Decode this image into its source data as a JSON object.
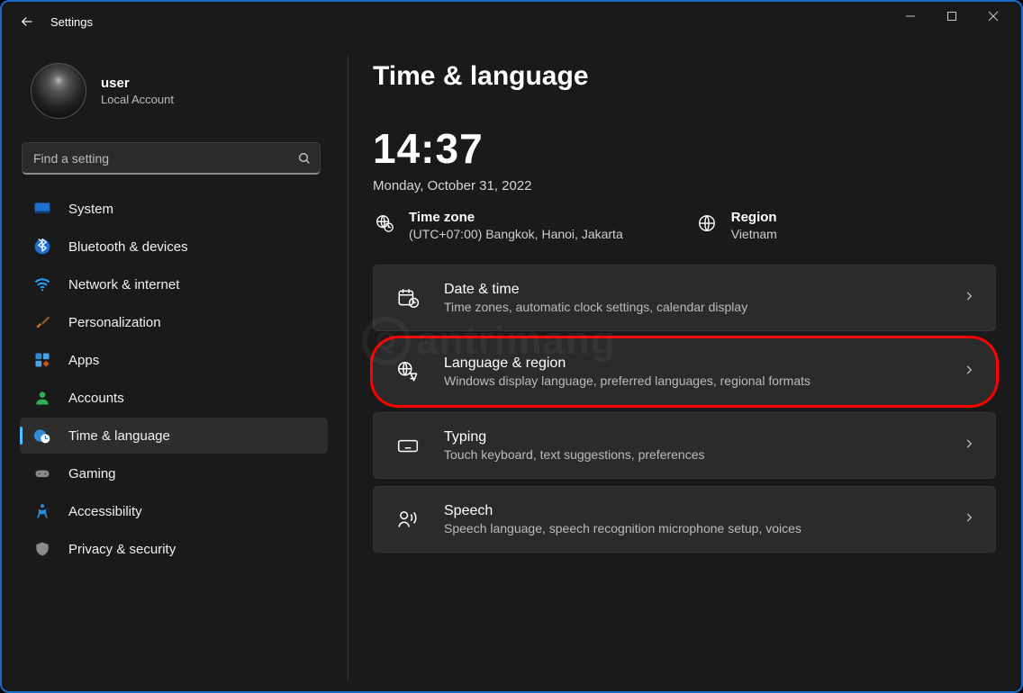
{
  "app": {
    "title": "Settings"
  },
  "profile": {
    "name": "user",
    "subtitle": "Local Account"
  },
  "search": {
    "placeholder": "Find a setting"
  },
  "sidebar": {
    "items": [
      {
        "label": "System"
      },
      {
        "label": "Bluetooth & devices"
      },
      {
        "label": "Network & internet"
      },
      {
        "label": "Personalization"
      },
      {
        "label": "Apps"
      },
      {
        "label": "Accounts"
      },
      {
        "label": "Time & language"
      },
      {
        "label": "Gaming"
      },
      {
        "label": "Accessibility"
      },
      {
        "label": "Privacy & security"
      }
    ],
    "active_index": 6
  },
  "page": {
    "title": "Time & language",
    "clock_time": "14:37",
    "clock_date": "Monday, October 31, 2022",
    "timezone": {
      "title": "Time zone",
      "value": "(UTC+07:00) Bangkok, Hanoi, Jakarta"
    },
    "region": {
      "title": "Region",
      "value": "Vietnam"
    },
    "cards": [
      {
        "title": "Date & time",
        "subtitle": "Time zones, automatic clock settings, calendar display"
      },
      {
        "title": "Language & region",
        "subtitle": "Windows display language, preferred languages, regional formats"
      },
      {
        "title": "Typing",
        "subtitle": "Touch keyboard, text suggestions, preferences"
      },
      {
        "title": "Speech",
        "subtitle": "Speech language, speech recognition microphone setup, voices"
      }
    ],
    "highlight_card_index": 1
  },
  "watermark": "antrimang"
}
